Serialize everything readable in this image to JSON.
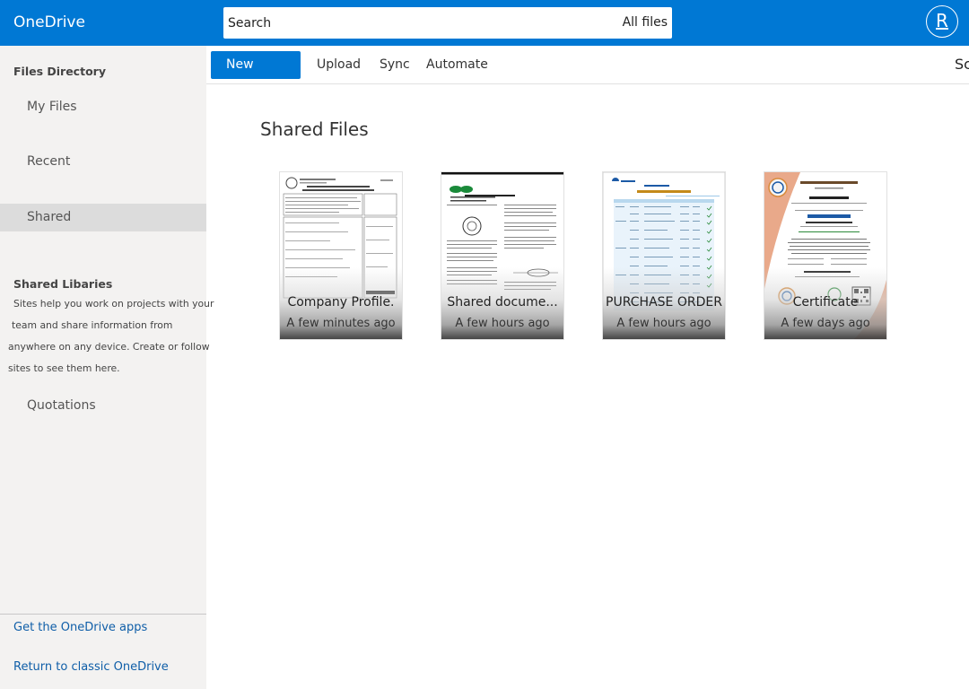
{
  "app": {
    "brand": "OneDrive",
    "accent": "#0078d4",
    "avatar_initial": "R"
  },
  "search": {
    "placeholder": "Search",
    "scope": "All files"
  },
  "sidebar": {
    "heading": "Files Directory",
    "items": [
      {
        "label": "My Files"
      },
      {
        "label": "Recent"
      },
      {
        "label": "Shared",
        "active": true
      }
    ],
    "libraries_heading": "Shared Libaries",
    "libraries_desc": [
      "Sites help you work on projects with your",
      "team and share information from",
      "anywhere on any device. Create or follow",
      "sites to see them here."
    ],
    "library_items": [
      {
        "label": "Quotations"
      }
    ],
    "footer_links": [
      {
        "label": "Get the OneDrive apps"
      },
      {
        "label": "Return to classic OneDrive"
      }
    ]
  },
  "toolbar": {
    "new_label": "New",
    "upload_label": "Upload",
    "sync_label": "Sync",
    "automate_label": "Automate",
    "right_label": "Sc"
  },
  "main": {
    "title": "Shared Files",
    "files": [
      {
        "name": "Company Profile.",
        "time": "A few minutes ago",
        "icon": "document-thumbnail"
      },
      {
        "name": "Shared docume...",
        "time": "A few hours ago",
        "icon": "document-thumbnail"
      },
      {
        "name": "PURCHASE ORDER",
        "time": "A few hours ago",
        "icon": "document-thumbnail"
      },
      {
        "name": "Certificate",
        "time": "A few days ago",
        "icon": "certificate-thumbnail"
      }
    ]
  }
}
